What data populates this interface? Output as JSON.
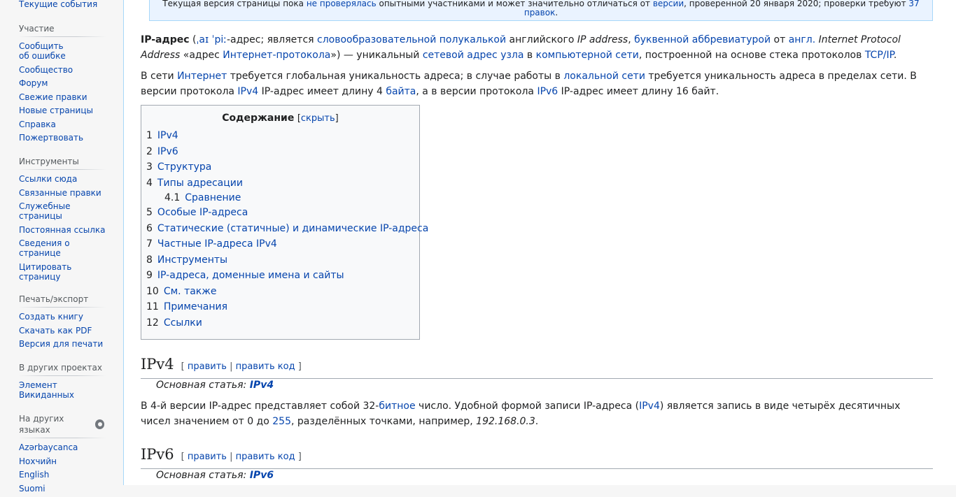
{
  "sidebar": {
    "top_item": "Текущие события",
    "participation": {
      "heading": "Участие",
      "items": [
        "Сообщить\nоб ошибке",
        "Сообщество",
        "Форум",
        "Свежие правки",
        "Новые страницы",
        "Справка",
        "Пожертвовать"
      ]
    },
    "tools": {
      "heading": "Инструменты",
      "items": [
        "Ссылки сюда",
        "Связанные правки",
        "Служебные страницы",
        "Постоянная ссылка",
        "Сведения о странице",
        "Цитировать страницу"
      ]
    },
    "print": {
      "heading": "Печать/экспорт",
      "items": [
        "Создать книгу",
        "Скачать как PDF",
        "Версия для печати"
      ]
    },
    "projects": {
      "heading": "В других проектах",
      "items": [
        "Элемент Викиданных"
      ]
    },
    "languages": {
      "heading": "На других языках",
      "items": [
        "Azərbaycanca",
        "Нохчийн",
        "English",
        "Suomi"
      ]
    }
  },
  "flagged": {
    "text_a": "Текущая версия страницы пока ",
    "link_a": "не проверялась",
    "text_b": " опытными участниками и может значительно отличаться от ",
    "link_b": "версии",
    "text_c": ", проверенной 20 января 2020; проверки требуют ",
    "link_c": "37 правок",
    "text_d": "."
  },
  "lead": {
    "term": "IP-адрес",
    "ipa_open": " (",
    "ipa": "ˌaɪ ˈpiː",
    "t1": "-адрес; является ",
    "l1": "словообразовательной полукалькой",
    "t2": " английского ",
    "i1": "IP address",
    "t3": ", ",
    "l2": "буквенной аббревиатурой",
    "t4": " от ",
    "l3": "англ.",
    "t5": " ",
    "i2": "Internet Protocol Address",
    "t6": " «адрес ",
    "l4": "Интернет-протокола",
    "t7": "») — уникальный ",
    "l5": "сетевой адрес узла",
    "t8": " в ",
    "l6": "компьютерной сети",
    "t9": ", построенной на основе стека протоколов ",
    "l7": "TCP/IP",
    "t10": "."
  },
  "second": {
    "t1": "В сети ",
    "l1": "Интернет",
    "t2": " требуется глобальная уникальность адреса; в случае работы в ",
    "l2": "локальной сети",
    "t3": " требуется уникальность адреса в пределах сети. В версии протокола ",
    "l3": "IPv4",
    "t4": " IP-адрес имеет длину 4 ",
    "l4": "байта",
    "t5": ", а в версии протокола ",
    "l5": "IPv6",
    "t6": " IP-адрес имеет длину 16 байт."
  },
  "toc": {
    "title": "Содержание",
    "toggle": "скрыть",
    "items": [
      {
        "num": "1",
        "label": "IPv4"
      },
      {
        "num": "2",
        "label": "IPv6"
      },
      {
        "num": "3",
        "label": "Структура"
      },
      {
        "num": "4",
        "label": "Типы адресации"
      },
      {
        "num": "4.1",
        "label": "Сравнение"
      },
      {
        "num": "5",
        "label": "Особые IP-адреса"
      },
      {
        "num": "6",
        "label": "Статические (статичные) и динамические IP-адреса"
      },
      {
        "num": "7",
        "label": "Частные IP-адреса IPv4"
      },
      {
        "num": "8",
        "label": "Инструменты"
      },
      {
        "num": "9",
        "label": "IP-адреса, доменные имена и сайты"
      },
      {
        "num": "10",
        "label": "См. также"
      },
      {
        "num": "11",
        "label": "Примечания"
      },
      {
        "num": "12",
        "label": "Ссылки"
      }
    ]
  },
  "ipv4": {
    "heading": "IPv4",
    "edit": "править",
    "edit_code": "править код",
    "hatnote_prefix": "Основная статья: ",
    "hatnote_link": "IPv4",
    "t1": "В 4-й версии IP-адрес представляет собой 32-",
    "l1": "битное",
    "t2": " число. Удобной формой записи IP-адреса (",
    "l2": "IPv4",
    "t3": ") является запись в виде четырёх десятичных чисел значением от 0 до ",
    "l3": "255",
    "t4": ", разделённых точками, например, ",
    "i1": "192.168.0.3",
    "t5": "."
  },
  "ipv6": {
    "heading": "IPv6",
    "edit": "править",
    "edit_code": "править код",
    "hatnote_prefix": "Основная статья: ",
    "hatnote_link": "IPv6"
  }
}
